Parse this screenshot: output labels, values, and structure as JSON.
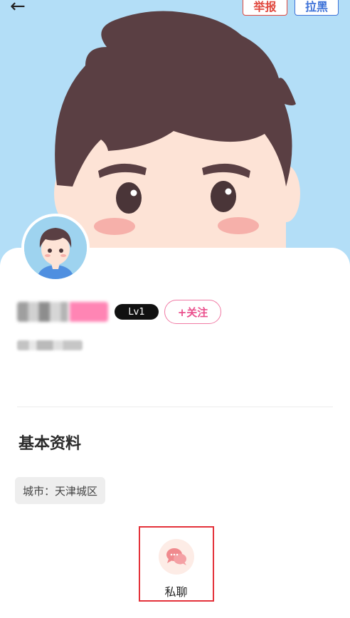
{
  "header": {
    "back_icon": "arrow-left-icon",
    "report_label": "举报",
    "block_label": "拉黑",
    "report_color": "#e0483e",
    "block_color": "#3e72d8"
  },
  "profile": {
    "level": "Lv1",
    "follow_label": "+关注",
    "accent_color": "#ea4f8c"
  },
  "basic_info": {
    "title": "基本资料",
    "city": "城市：天津城区"
  },
  "actions": {
    "chat_label": "私聊",
    "chat_icon": "chat-bubbles-icon"
  }
}
